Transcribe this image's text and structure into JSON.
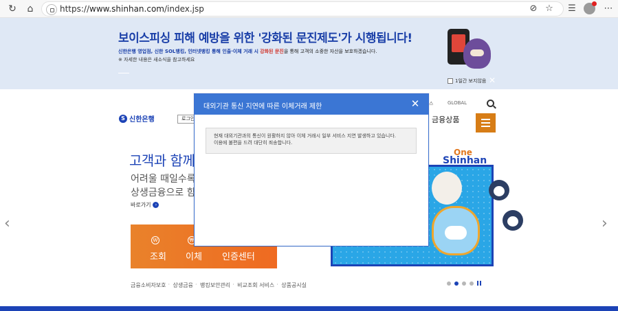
{
  "browser": {
    "url_prefix": "https://",
    "url_host": "www.shinhan.com",
    "url_path": "/index.jsp"
  },
  "notice_banner": {
    "headline": "보이스피싱 피해 예방을 위한 '강화된 문진제도'가 시행됩니다!",
    "line1_lead": "신한은행 영업점, 신한 SOL뱅킹, 인터넷뱅킹 통해 인출·이체 거래 시",
    "line1_highlight": "강화된 문진",
    "line1_tail": "을 통해 고객의 소중한 자산을 보호하겠습니다.",
    "line2": "※ 자세한 내용은 새소식을 참고하세요",
    "dont_show_label": "1일간 보지않음"
  },
  "header": {
    "logo_text": "신한은행",
    "login_label": "로그인",
    "top_links": [
      "스",
      "GLOBAL"
    ],
    "gnb_label": "금융상품"
  },
  "hero": {
    "title": "고객과 함께",
    "subtitle1": "어려울 때일수록 고",
    "subtitle2": "상생금융으로 함께",
    "shortcut_label": "바로가기",
    "quick_menu": [
      "조회",
      "이체",
      "인증센터"
    ],
    "quick_icons": [
      "W",
      "₩"
    ]
  },
  "promo": {
    "brand_top": "One",
    "brand_bottom": "Shinhan"
  },
  "footer_links": [
    "금융소비자보호",
    "상생금융",
    "뱅킹보안관리",
    "비교조회 서비스",
    "상품공시실"
  ],
  "modal": {
    "title": "대외기관 통신 지연에 따른 이체거래 제한",
    "message_line1": "현재 대외기관과의 통신이 원활하지 않아 이체 거래시 일부 서비스 지연 발생하고 있습니다.",
    "message_line2": "이용에 불편을 드려 대단히 죄송합니다."
  },
  "colors": {
    "brand_blue": "#1c43b6",
    "modal_header": "#3b76d4",
    "accent_orange": "#d77d16"
  }
}
